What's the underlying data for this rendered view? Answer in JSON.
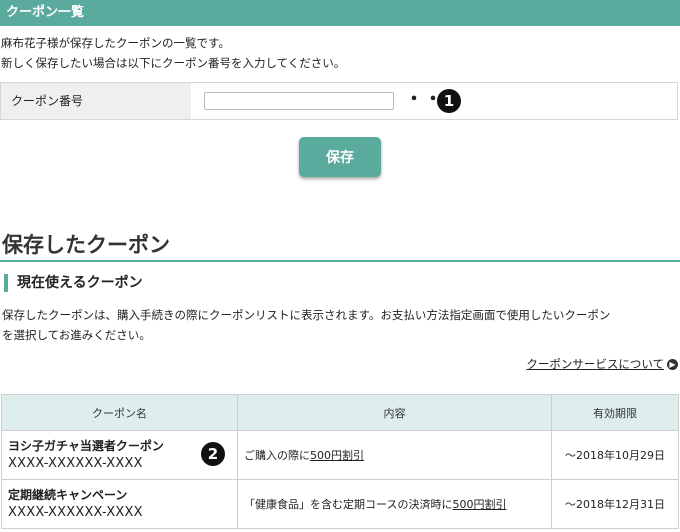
{
  "header": {
    "title": "クーポン一覧"
  },
  "intro": {
    "line1": "麻布花子様が保存したクーポンの一覧です。",
    "line2": "新しく保存したい場合は以下にクーポン番号を入力してください。"
  },
  "form": {
    "label": "クーポン番号",
    "input_value": "",
    "dots": "・・・",
    "badge": "1"
  },
  "save_button": {
    "label": "保存"
  },
  "section": {
    "title": "保存したクーポン",
    "subtitle": "現在使えるクーポン",
    "desc_line1": "保存したクーポンは、購入手続きの際にクーポンリストに表示されます。お支払い方法指定画面で使用したいクーポン",
    "desc_line2": "を選択してお進みください。",
    "about_link": "クーポンサービスについて"
  },
  "table": {
    "headers": [
      "クーポン名",
      "内容",
      "有効期限"
    ],
    "rows": [
      {
        "name": "ヨシ子ガチャ当選者クーポン",
        "code": "XXXX-XXXXXX-XXXX",
        "content_prefix": "ご購入の際に",
        "content_discount": "500円割引",
        "expiry": "～2018年10月29日",
        "badge": "2"
      },
      {
        "name": "定期継続キャンペーン",
        "code": "XXXX-XXXXXX-XXXX",
        "content_prefix": "「健康食品」を含む定期コースの決済時に",
        "content_discount": "500円割引",
        "expiry": "～2018年12月31日"
      }
    ]
  },
  "colors": {
    "accent": "#5aaa9e",
    "table_header_bg": "#ddeeed",
    "label_bg": "#efefef"
  },
  "icons": {
    "link_arrow": "arrow-right-circle-icon"
  }
}
